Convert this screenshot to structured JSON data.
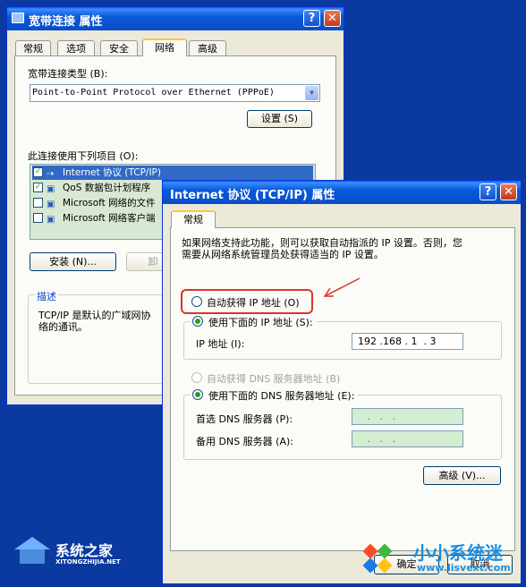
{
  "back_window": {
    "title": "宽带连接 属性",
    "help_button": "?",
    "close_button": "✕",
    "tabs": [
      "常规",
      "选项",
      "安全",
      "网络",
      "高级"
    ],
    "active_tab": "网络",
    "type_label": "宽带连接类型 (B):",
    "type_value": "Point-to-Point Protocol over Ethernet (PPPoE)",
    "settings_button": "设置 (S)",
    "items_label": "此连接使用下列项目 (O):",
    "items": [
      {
        "label": "Internet 协议 (TCP/IP)",
        "checked": true,
        "selected": true
      },
      {
        "label": "QoS 数据包计划程序",
        "checked": true,
        "selected": false
      },
      {
        "label": "Microsoft 网络的文件",
        "checked": false,
        "selected": false
      },
      {
        "label": "Microsoft 网络客户端",
        "checked": false,
        "selected": false
      }
    ],
    "install_button": "安装 (N)...",
    "uninstall_button": "卸",
    "desc_title": "描述",
    "desc_text": "TCP/IP 是默认的广域网协\n络的通讯。"
  },
  "front_window": {
    "title": "Internet 协议 (TCP/IP) 属性",
    "help_button": "?",
    "close_button": "✕",
    "tab": "常规",
    "info_text": "如果网络支持此功能，则可以获取自动指派的 IP 设置。否则，您需要从网络系统管理员处获得适当的 IP 设置。",
    "auto_ip_label": "自动获得 IP 地址 (O)",
    "manual_ip_label": "使用下面的 IP 地址 (S):",
    "ip_label": "IP 地址 (I):",
    "ip_value": "192 .168 . 1  . 3",
    "auto_dns_label": "自动获得 DNS 服务器地址 (B)",
    "manual_dns_label": "使用下面的 DNS 服务器地址 (E):",
    "preferred_dns_label": "首选 DNS 服务器 (P):",
    "preferred_dns_value": "   .   .   .",
    "alternate_dns_label": "备用 DNS 服务器 (A):",
    "alternate_dns_value": "   .   .   .",
    "advanced_button": "高级 (V)...",
    "ok_button": "确定",
    "cancel_button": "取消"
  },
  "watermarks": {
    "left_name": "系统之家",
    "left_url": "XITONGZHIJIA.NET",
    "right_name": "小小系统迷",
    "right_url": "www.lisvext.com"
  },
  "colors": {
    "highlight_box": "#e0312a",
    "arrow": "#e0312a",
    "title_bar": "#0a5ad8"
  }
}
